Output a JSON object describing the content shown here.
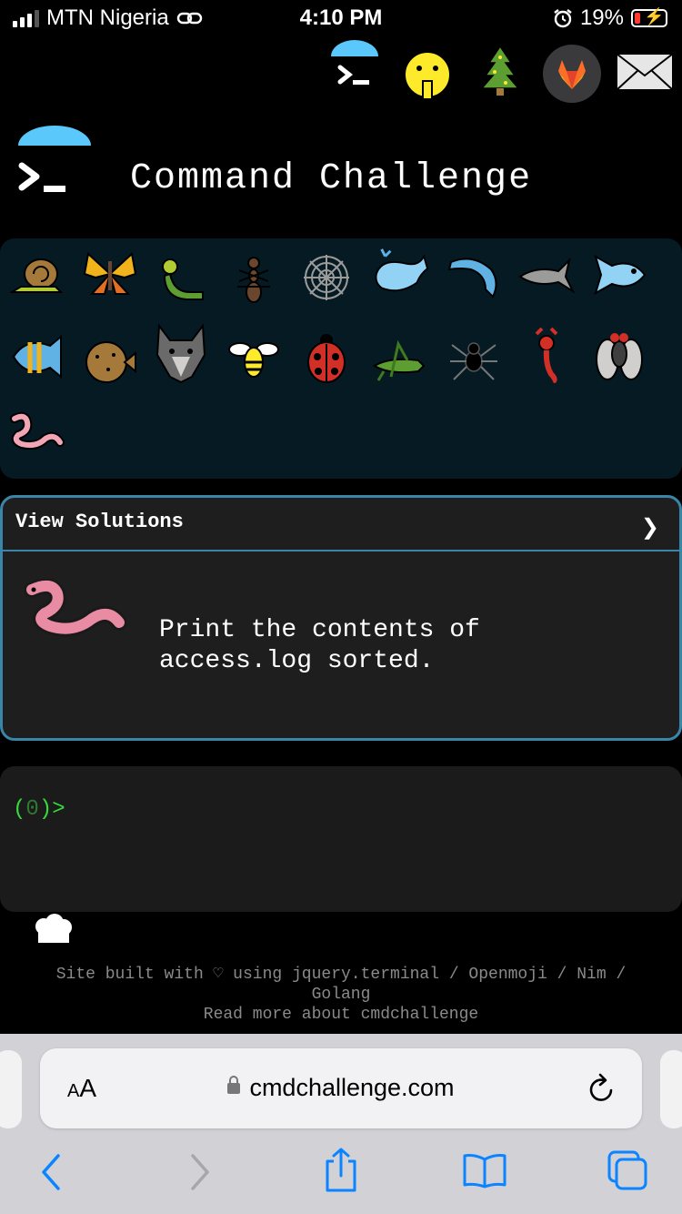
{
  "status_bar": {
    "carrier": "MTN Nigeria",
    "time": "4:10 PM",
    "battery_percent": "19%",
    "battery_level": 0.19
  },
  "top_icons": [
    "cmdchallenge-logo-icon",
    "shushing-face-icon",
    "tree-icon",
    "gitlab-icon",
    "envelope-icon"
  ],
  "header": {
    "title": "Command Challenge"
  },
  "badges": [
    "snail",
    "butterfly",
    "caterpillar",
    "ant",
    "spider-web",
    "whale",
    "dolphin",
    "shark",
    "fish",
    "tropical-fish",
    "blowfish",
    "wolf",
    "bee",
    "ladybug",
    "cricket",
    "spider",
    "scorpion",
    "fly",
    "worm"
  ],
  "challenge": {
    "header_label": "View Solutions",
    "chevron": "❯",
    "text": "Print the contents of\naccess.log sorted."
  },
  "terminal": {
    "prompt_open": "(",
    "count": "0",
    "prompt_close": ")>"
  },
  "footer": {
    "line1": "Site built with ♡ using jquery.terminal / Openmoji / Nim /",
    "line2": "Golang",
    "line3": "Read more about cmdchallenge"
  },
  "safari": {
    "text_size_label": "AA",
    "url": "cmdchallenge.com"
  },
  "colors": {
    "accent_blue": "#3a85a8",
    "panel": "#061a24",
    "prompt_green": "#37d83b",
    "ios_blue": "#0a84ff"
  }
}
